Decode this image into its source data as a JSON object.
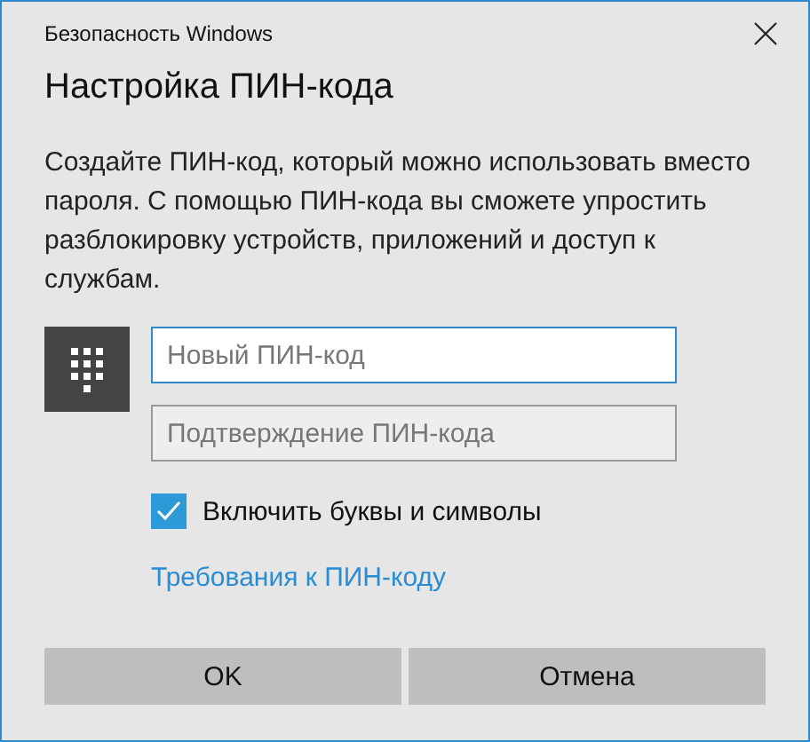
{
  "window": {
    "title": "Безопасность Windows"
  },
  "heading": "Настройка ПИН-кода",
  "description": "Создайте ПИН-код, который можно использовать вместо пароля. С помощью ПИН-кода вы сможете упростить разблокировку устройств, приложений и доступ к службам.",
  "fields": [
    {
      "placeholder": "Новый ПИН-код",
      "focused": true
    },
    {
      "placeholder": "Подтверждение ПИН-кода",
      "focused": false
    }
  ],
  "checkbox": {
    "label": "Включить буквы и символы",
    "checked": true
  },
  "link": "Требования к ПИН-коду",
  "buttons": [
    "OK",
    "Отмена"
  ]
}
